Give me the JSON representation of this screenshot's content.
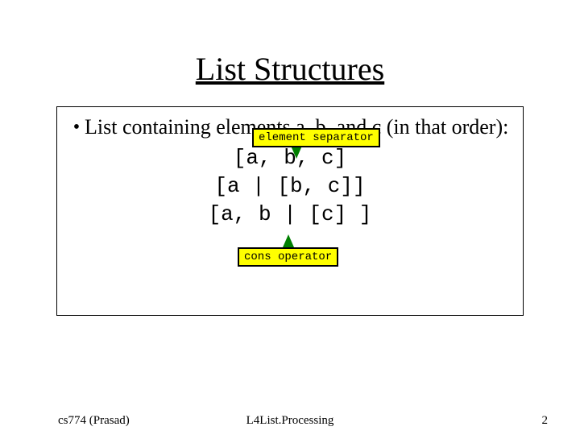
{
  "title": "List Structures",
  "bullet_text": "List containing elements a, b, and c (in that order):",
  "callout_top": "element separator",
  "callout_bottom": "cons operator",
  "code_lines": [
    "[a, b, c]",
    "[a | [b, c]]",
    "[a, b | [c] ]"
  ],
  "footer": {
    "left": "cs774 (Prasad)",
    "center": "L4List.Processing",
    "right": "2"
  }
}
